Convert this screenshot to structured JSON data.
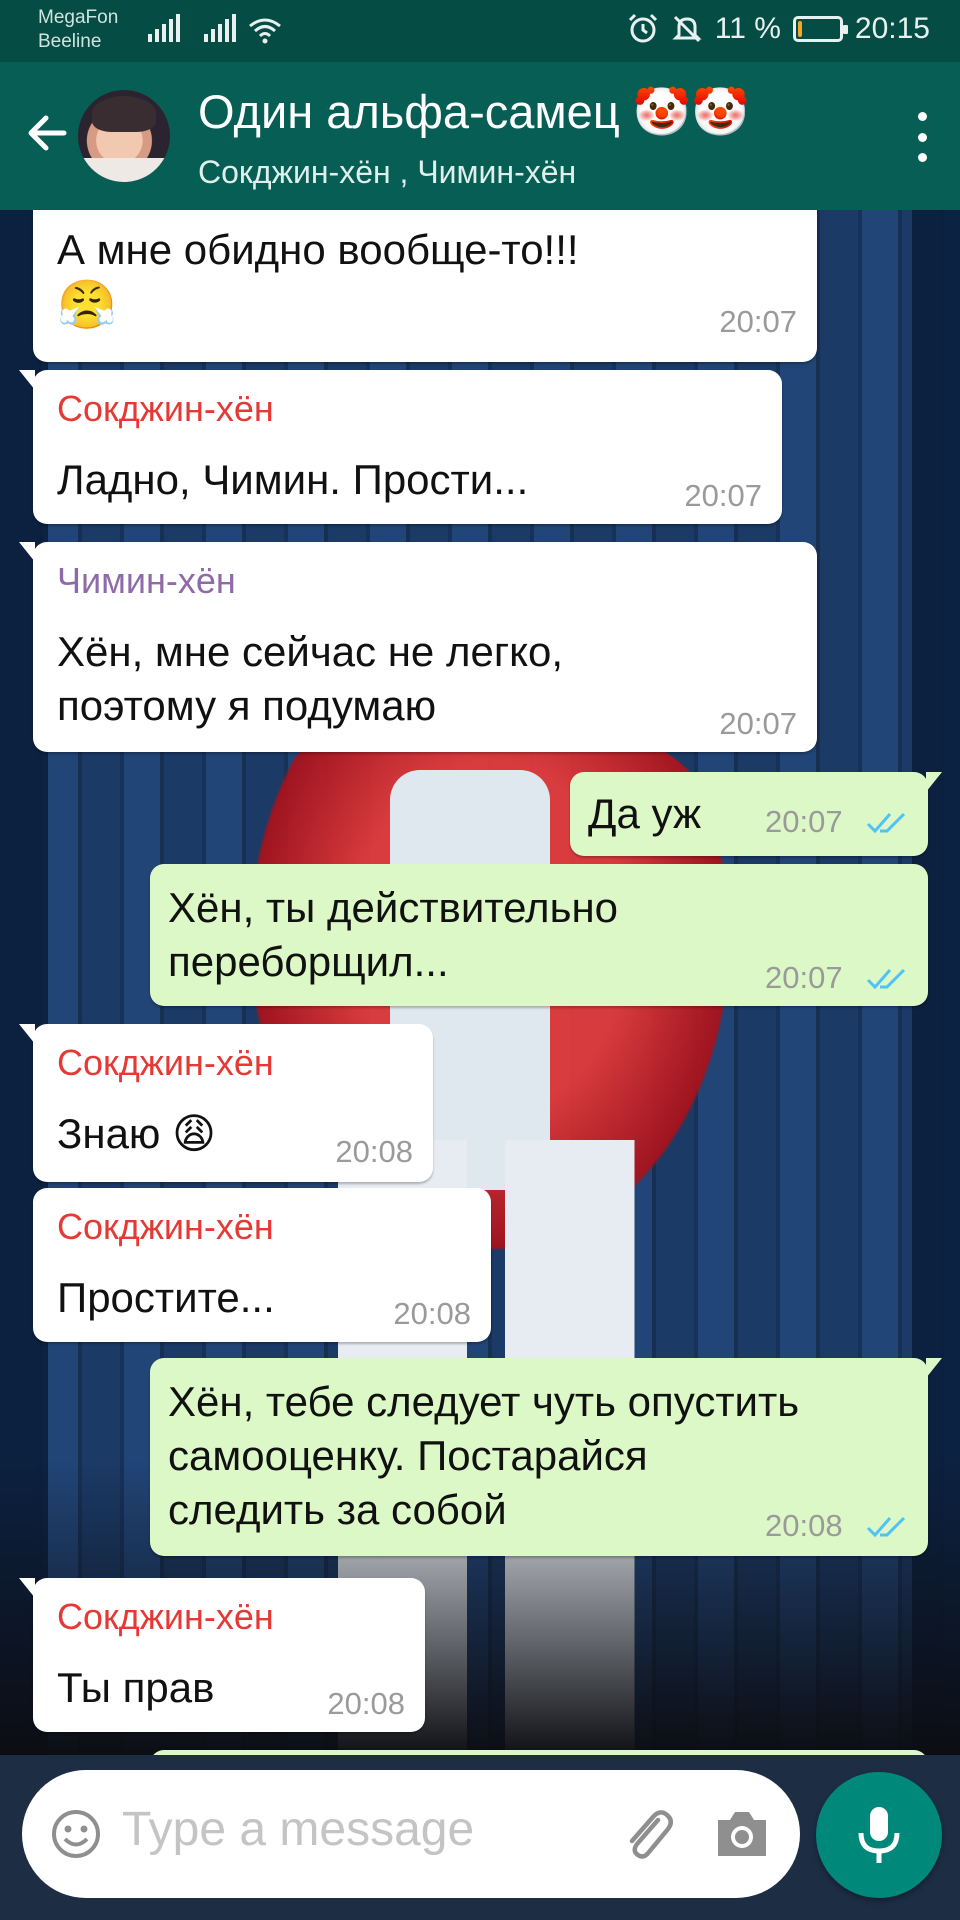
{
  "status_bar": {
    "carrier_1": "MegaFon",
    "carrier_2": "Beeline",
    "battery_percent_text": "11 %",
    "battery_level": 0.11,
    "clock": "20:15",
    "icons": [
      "signal-icon",
      "signal-icon",
      "wifi-icon",
      "alarm-icon",
      "mute-icon",
      "battery-icon"
    ]
  },
  "header": {
    "title": "Один альфа-самец 🤡🤡",
    "subtitle": "Сокджин-хён , Чимин-хён",
    "icons": [
      "back-arrow-icon",
      "avatar",
      "more-vert-icon"
    ]
  },
  "messages": [
    {
      "direction": "in",
      "sender": "",
      "lines": [
        "А мне обидно вообще-то!!!",
        "😤"
      ],
      "time": "20:07"
    },
    {
      "direction": "in",
      "sender": "Сокджин-хён",
      "sender_color": "#e53935",
      "lines": [
        "Ладно, Чимин. Прости..."
      ],
      "time": "20:07"
    },
    {
      "direction": "in",
      "sender": "Чимин-хён",
      "sender_color": "#8e6aa8",
      "lines": [
        "Хён, мне сейчас не легко,",
        "поэтому я подумаю"
      ],
      "time": "20:07"
    },
    {
      "direction": "out",
      "lines": [
        "Да уж"
      ],
      "time": "20:07",
      "read": true
    },
    {
      "direction": "out",
      "lines": [
        "Хён, ты действительно",
        "переборщил..."
      ],
      "time": "20:07",
      "read": true
    },
    {
      "direction": "in",
      "sender": "Сокджин-хён",
      "sender_color": "#e53935",
      "lines": [
        "Знаю 😩"
      ],
      "time": "20:08"
    },
    {
      "direction": "in",
      "sender": "Сокджин-хён",
      "sender_color": "#e53935",
      "lines": [
        "Простите..."
      ],
      "time": "20:08"
    },
    {
      "direction": "out",
      "lines": [
        "Хён, тебе следует чуть опустить",
        "самооценку. Постарайся",
        "следить за собой"
      ],
      "time": "20:08",
      "read": true
    },
    {
      "direction": "in",
      "sender": "Сокджин-хён",
      "sender_color": "#e53935",
      "lines": [
        "Ты прав"
      ],
      "time": "20:08"
    }
  ],
  "input": {
    "placeholder": "Type a message",
    "icons": [
      "emoji-icon",
      "attach-icon",
      "camera-icon",
      "mic-icon"
    ]
  },
  "colors": {
    "header_bg": "#075e54",
    "outgoing_bubble": "#dcf8c6",
    "incoming_bubble": "#ffffff",
    "read_ticks": "#4fc3f7",
    "mic_button": "#00897b"
  }
}
